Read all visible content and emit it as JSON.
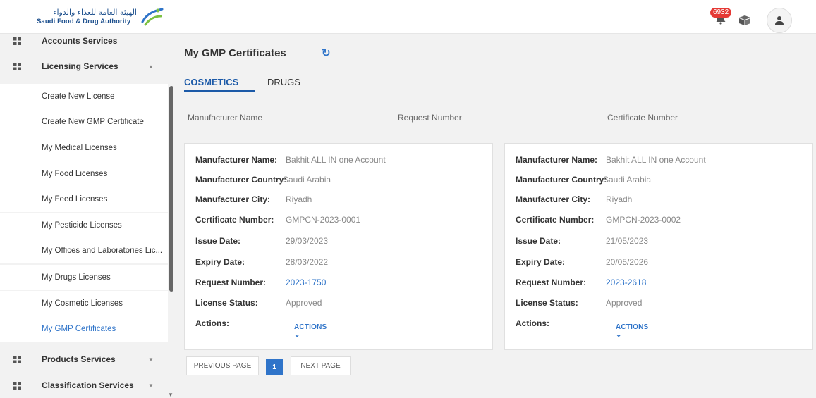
{
  "header": {
    "logo_ar": "الهيئة العامة للغذاء والدواء",
    "logo_en": "Saudi Food & Drug Authority",
    "notifications_count": "6932"
  },
  "sidebar": {
    "groups": [
      {
        "label": "Accounts Services"
      },
      {
        "label": "Licensing Services",
        "caret": "▲"
      },
      {
        "label": "Products Services",
        "caret": "▼"
      },
      {
        "label": "Classification Services",
        "caret": "▼"
      }
    ],
    "items": [
      {
        "label": "Create New License"
      },
      {
        "label": "Create New GMP Certificate"
      },
      {
        "label": "My Medical Licenses"
      },
      {
        "label": "My Food Licenses"
      },
      {
        "label": "My Feed Licenses"
      },
      {
        "label": "My Pesticide Licenses"
      },
      {
        "label": "My Offices and Laboratories Lic..."
      },
      {
        "label": "My Drugs Licenses"
      },
      {
        "label": "My Cosmetic Licenses"
      },
      {
        "label": "My GMP Certificates"
      }
    ]
  },
  "main": {
    "title": "My GMP Certificates",
    "tabs": [
      {
        "label": "COSMETICS",
        "active": true
      },
      {
        "label": "DRUGS",
        "active": false
      }
    ],
    "filters": {
      "manufacturer_name": "Manufacturer Name",
      "request_number": "Request Number",
      "certificate_number": "Certificate Number"
    },
    "field_labels": {
      "manufacturer_name": "Manufacturer Name:",
      "manufacturer_country": "Manufacturer Country:",
      "manufacturer_city": "Manufacturer City:",
      "certificate_number": "Certificate Number:",
      "issue_date": "Issue Date:",
      "expiry_date": "Expiry Date:",
      "request_number": "Request Number:",
      "license_status": "License Status:",
      "actions": "Actions:",
      "actions_button": "ACTIONS ⌄"
    },
    "cards": [
      {
        "manufacturer_name": "Bakhit ALL IN one Account",
        "manufacturer_country": "Saudi Arabia",
        "manufacturer_city": "Riyadh",
        "certificate_number": "GMPCN-2023-0001",
        "issue_date": "29/03/2023",
        "expiry_date": "28/03/2022",
        "request_number": "2023-1750",
        "license_status": "Approved"
      },
      {
        "manufacturer_name": "Bakhit ALL IN one Account",
        "manufacturer_country": "Saudi Arabia",
        "manufacturer_city": "Riyadh",
        "certificate_number": "GMPCN-2023-0002",
        "issue_date": "21/05/2023",
        "expiry_date": "20/05/2026",
        "request_number": "2023-2618",
        "license_status": "Approved"
      }
    ],
    "pagination": {
      "previous": "PREVIOUS PAGE",
      "current": "1",
      "next": "NEXT PAGE"
    }
  },
  "colors": {
    "accent": "#2f74c9",
    "tab_active": "#1c5aa8",
    "badge": "#e53935",
    "background": "#f2f2f2"
  }
}
